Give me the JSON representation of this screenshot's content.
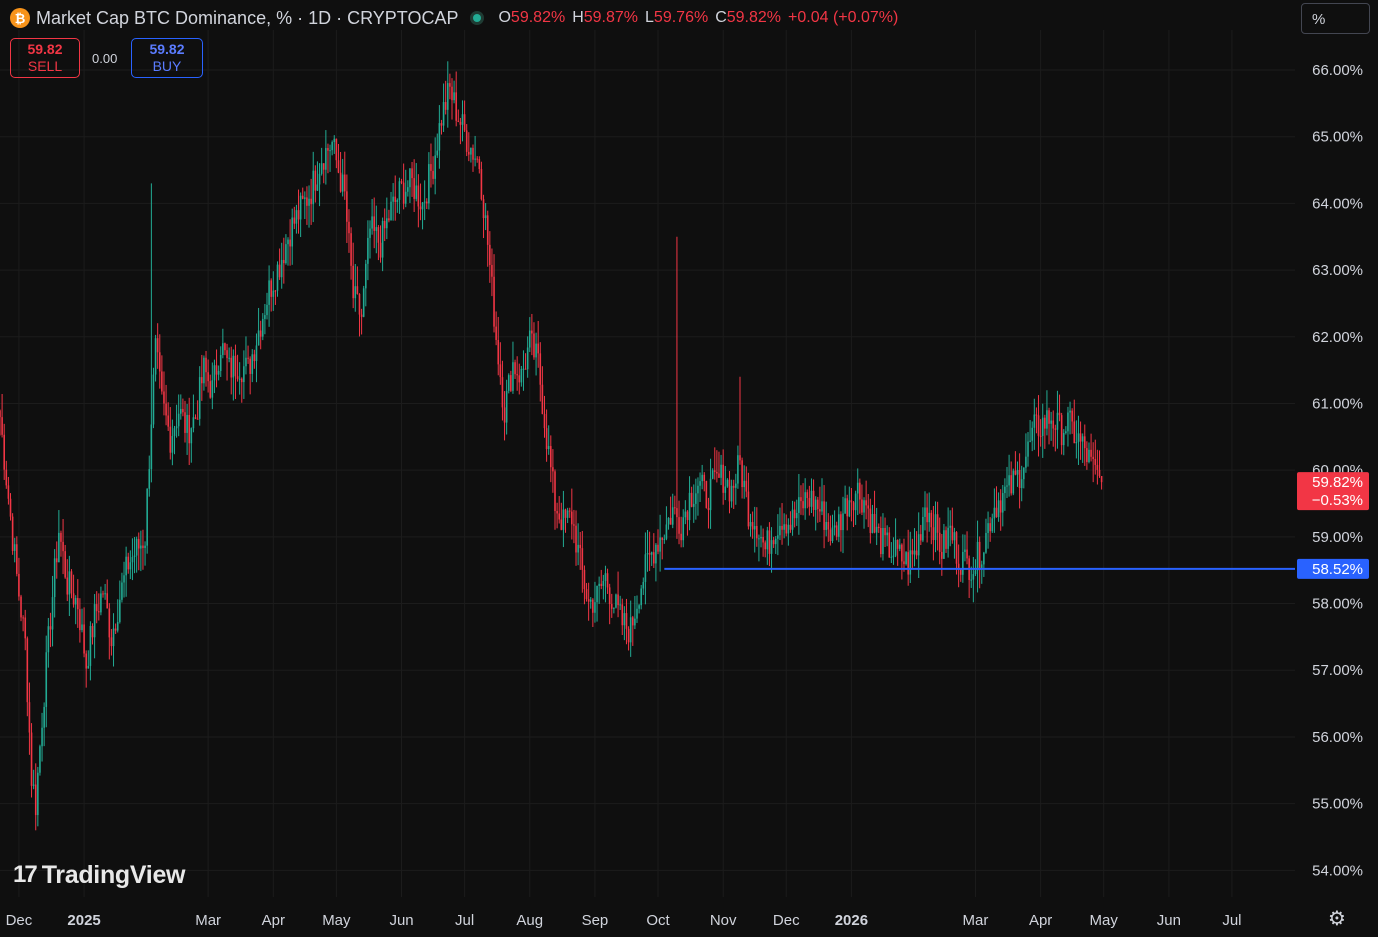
{
  "header": {
    "title": "Market Cap BTC Dominance, % · 1D · CRYPTOCAP",
    "icon": "bitcoin-icon",
    "ohlc": {
      "o_label": "O",
      "o": "59.82%",
      "h_label": "H",
      "h": "59.87%",
      "l_label": "L",
      "l": "59.76%",
      "c_label": "C",
      "c": "59.82%",
      "change": "+0.04 (+0.07%)"
    }
  },
  "trade": {
    "sell_price": "59.82",
    "sell_label": "SELL",
    "spread": "0.00",
    "buy_price": "59.82",
    "buy_label": "BUY"
  },
  "scale_mode": "%",
  "logo_text": "TradingView",
  "colors": {
    "up": "#22ab94",
    "down": "#f23645",
    "line": "#2962ff",
    "background": "#0f0f0f",
    "grid": "#1c1c1c"
  },
  "chart_data": {
    "type": "candlestick",
    "series_label": "Market Cap BTC Dominance, %",
    "interval": "1D",
    "ylim": [
      53.6,
      66.6
    ],
    "xlim": [
      "2024-11-22",
      "2026-07-31"
    ],
    "grid": true,
    "y_ticks": [
      "54.00%",
      "55.00%",
      "56.00%",
      "57.00%",
      "58.00%",
      "59.00%",
      "60.00%",
      "61.00%",
      "62.00%",
      "63.00%",
      "64.00%",
      "65.00%",
      "66.00%"
    ],
    "y_tick_values": [
      54,
      55,
      56,
      57,
      58,
      59,
      60,
      61,
      62,
      63,
      64,
      65,
      66
    ],
    "x_ticks": [
      {
        "label": "Dec",
        "date": "2024-12-01"
      },
      {
        "label": "2025",
        "date": "2025-01-01",
        "bold": true
      },
      {
        "label": "Mar",
        "date": "2025-03-01"
      },
      {
        "label": "Apr",
        "date": "2025-04-01"
      },
      {
        "label": "May",
        "date": "2025-05-01"
      },
      {
        "label": "Jun",
        "date": "2025-06-01"
      },
      {
        "label": "Jul",
        "date": "2025-07-01"
      },
      {
        "label": "Aug",
        "date": "2025-08-01"
      },
      {
        "label": "Sep",
        "date": "2025-09-01"
      },
      {
        "label": "Oct",
        "date": "2025-10-01"
      },
      {
        "label": "Nov",
        "date": "2025-11-01"
      },
      {
        "label": "Dec",
        "date": "2025-12-01"
      },
      {
        "label": "2026",
        "date": "2026-01-01",
        "bold": true
      },
      {
        "label": "Mar",
        "date": "2026-03-01"
      },
      {
        "label": "Apr",
        "date": "2026-04-01"
      },
      {
        "label": "May",
        "date": "2026-05-01"
      },
      {
        "label": "Jun",
        "date": "2026-06-01"
      },
      {
        "label": "Jul",
        "date": "2026-07-01"
      }
    ],
    "close_path": [
      [
        "2024-11-22",
        60.8
      ],
      [
        "2024-11-26",
        59.6
      ],
      [
        "2024-11-30",
        58.4
      ],
      [
        "2024-12-04",
        57.4
      ],
      [
        "2024-12-07",
        55.4
      ],
      [
        "2024-12-09",
        55.0
      ],
      [
        "2024-12-12",
        56.3
      ],
      [
        "2024-12-16",
        57.8
      ],
      [
        "2024-12-20",
        59.1
      ],
      [
        "2024-12-24",
        58.3
      ],
      [
        "2024-12-29",
        58.0
      ],
      [
        "2025-01-02",
        57.1
      ],
      [
        "2025-01-06",
        57.8
      ],
      [
        "2025-01-10",
        58.2
      ],
      [
        "2025-01-14",
        57.5
      ],
      [
        "2025-01-18",
        58.1
      ],
      [
        "2025-01-22",
        58.6
      ],
      [
        "2025-01-26",
        58.8
      ],
      [
        "2025-01-30",
        59.0
      ],
      [
        "2025-02-02",
        60.8
      ],
      [
        "2025-02-04",
        61.8
      ],
      [
        "2025-02-07",
        61.0
      ],
      [
        "2025-02-11",
        60.5
      ],
      [
        "2025-02-15",
        60.9
      ],
      [
        "2025-02-19",
        60.6
      ],
      [
        "2025-02-23",
        60.8
      ],
      [
        "2025-02-27",
        61.5
      ],
      [
        "2025-03-03",
        61.2
      ],
      [
        "2025-03-07",
        61.9
      ],
      [
        "2025-03-11",
        61.5
      ],
      [
        "2025-03-15",
        61.6
      ],
      [
        "2025-03-20",
        61.5
      ],
      [
        "2025-03-25",
        62.1
      ],
      [
        "2025-03-30",
        62.7
      ],
      [
        "2025-04-04",
        63.1
      ],
      [
        "2025-04-09",
        63.6
      ],
      [
        "2025-04-14",
        63.9
      ],
      [
        "2025-04-19",
        64.2
      ],
      [
        "2025-04-24",
        64.7
      ],
      [
        "2025-04-29",
        64.9
      ],
      [
        "2025-05-05",
        64.1
      ],
      [
        "2025-05-09",
        62.6
      ],
      [
        "2025-05-13",
        62.3
      ],
      [
        "2025-05-17",
        63.6
      ],
      [
        "2025-05-22",
        63.4
      ],
      [
        "2025-05-27",
        63.9
      ],
      [
        "2025-06-01",
        64.2
      ],
      [
        "2025-06-06",
        64.3
      ],
      [
        "2025-06-11",
        64.0
      ],
      [
        "2025-06-16",
        64.6
      ],
      [
        "2025-06-20",
        65.3
      ],
      [
        "2025-06-24",
        65.7
      ],
      [
        "2025-06-28",
        65.3
      ],
      [
        "2025-07-03",
        64.9
      ],
      [
        "2025-07-08",
        64.6
      ],
      [
        "2025-07-12",
        63.4
      ],
      [
        "2025-07-16",
        62.0
      ],
      [
        "2025-07-20",
        60.9
      ],
      [
        "2025-07-24",
        61.6
      ],
      [
        "2025-07-28",
        61.4
      ],
      [
        "2025-08-01",
        61.9
      ],
      [
        "2025-08-05",
        61.6
      ],
      [
        "2025-08-09",
        60.5
      ],
      [
        "2025-08-13",
        59.5
      ],
      [
        "2025-08-17",
        59.2
      ],
      [
        "2025-08-21",
        59.3
      ],
      [
        "2025-08-25",
        58.6
      ],
      [
        "2025-08-29",
        58.0
      ],
      [
        "2025-09-02",
        58.1
      ],
      [
        "2025-09-06",
        58.4
      ],
      [
        "2025-09-10",
        58.0
      ],
      [
        "2025-09-14",
        57.7
      ],
      [
        "2025-09-18",
        57.6
      ],
      [
        "2025-09-22",
        58.2
      ],
      [
        "2025-09-26",
        58.6
      ],
      [
        "2025-09-30",
        58.9
      ],
      [
        "2025-10-04",
        59.1
      ],
      [
        "2025-10-08",
        59.4
      ],
      [
        "2025-10-12",
        59.2
      ],
      [
        "2025-10-16",
        59.6
      ],
      [
        "2025-10-20",
        59.8
      ],
      [
        "2025-10-24",
        59.6
      ],
      [
        "2025-10-28",
        59.8
      ],
      [
        "2025-11-01",
        59.9
      ],
      [
        "2025-11-05",
        59.7
      ],
      [
        "2025-11-09",
        60.1
      ],
      [
        "2025-11-13",
        59.4
      ],
      [
        "2025-11-17",
        59.2
      ],
      [
        "2025-11-21",
        58.8
      ],
      [
        "2025-11-25",
        59.1
      ],
      [
        "2025-11-29",
        59.3
      ],
      [
        "2025-12-03",
        59.2
      ],
      [
        "2025-12-07",
        59.4
      ],
      [
        "2025-12-11",
        59.6
      ],
      [
        "2025-12-15",
        59.5
      ],
      [
        "2025-12-19",
        59.3
      ],
      [
        "2025-12-23",
        59.0
      ],
      [
        "2025-12-27",
        59.3
      ],
      [
        "2025-12-31",
        59.6
      ],
      [
        "2026-01-04",
        59.7
      ],
      [
        "2026-01-08",
        59.5
      ],
      [
        "2026-01-12",
        59.1
      ],
      [
        "2026-01-16",
        58.9
      ],
      [
        "2026-01-20",
        58.8
      ],
      [
        "2026-01-24",
        58.7
      ],
      [
        "2026-01-28",
        58.6
      ],
      [
        "2026-02-01",
        58.8
      ],
      [
        "2026-02-05",
        59.5
      ],
      [
        "2026-02-09",
        59.2
      ],
      [
        "2026-02-13",
        58.8
      ],
      [
        "2026-02-17",
        59.1
      ],
      [
        "2026-02-21",
        58.7
      ],
      [
        "2026-02-25",
        58.6
      ],
      [
        "2026-03-01",
        58.6
      ],
      [
        "2026-03-05",
        58.9
      ],
      [
        "2026-03-09",
        59.4
      ],
      [
        "2026-03-13",
        59.6
      ],
      [
        "2026-03-17",
        59.7
      ],
      [
        "2026-03-21",
        59.9
      ],
      [
        "2026-03-25",
        60.2
      ],
      [
        "2026-03-29",
        60.6
      ],
      [
        "2026-04-02",
        60.7
      ],
      [
        "2026-04-06",
        60.8
      ],
      [
        "2026-04-10",
        60.6
      ],
      [
        "2026-04-14",
        60.7
      ],
      [
        "2026-04-18",
        60.5
      ],
      [
        "2026-04-22",
        60.3
      ],
      [
        "2026-04-26",
        60.0
      ],
      [
        "2026-04-30",
        59.82
      ]
    ],
    "candles": [],
    "horizontal_line": {
      "value": 58.52,
      "from_date": "2025-10-04",
      "color": "#2962ff",
      "width": 2
    },
    "price_tags": [
      {
        "lines": [
          "59.82%",
          "−0.53%"
        ],
        "value": 59.82,
        "color": "#f23645"
      },
      {
        "lines": [
          "58.52%"
        ],
        "value": 58.52,
        "color": "#2962ff"
      }
    ]
  }
}
